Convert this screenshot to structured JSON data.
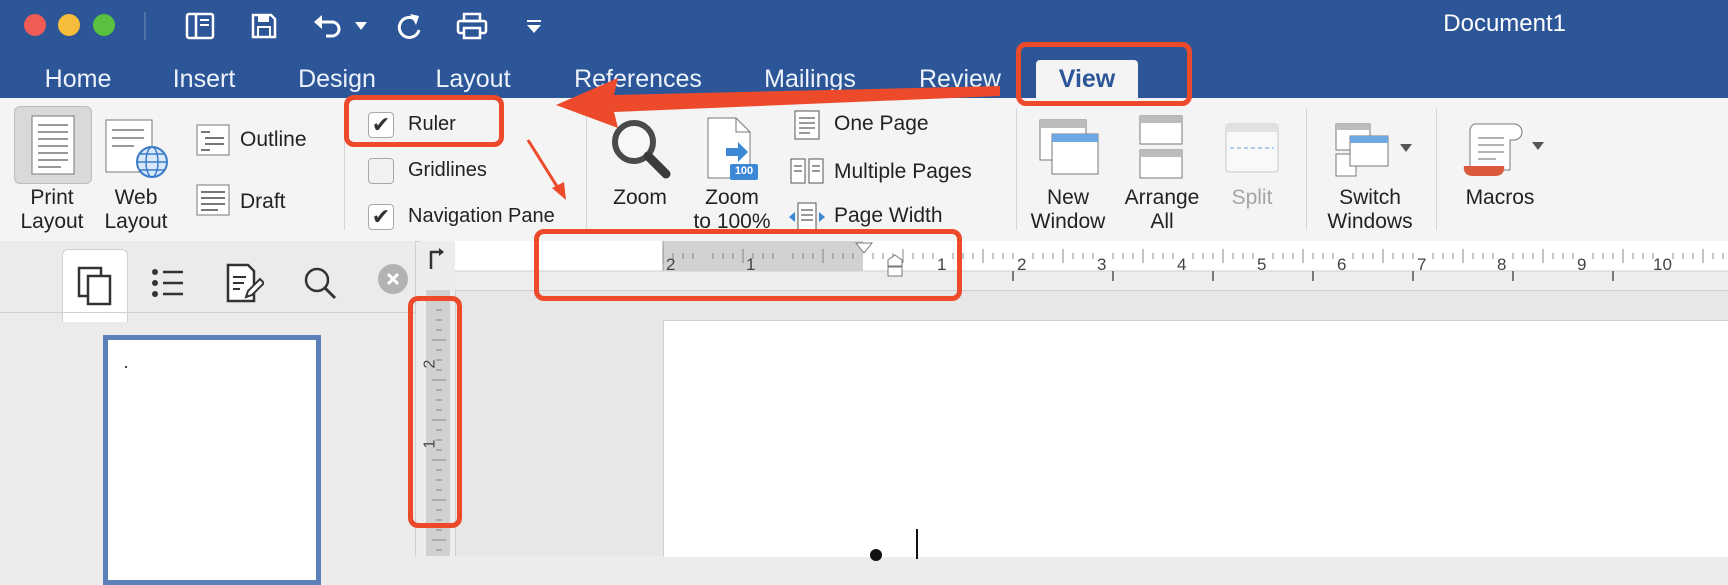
{
  "window": {
    "title": "Document1"
  },
  "tabs": [
    {
      "label": "Home"
    },
    {
      "label": "Insert"
    },
    {
      "label": "Design"
    },
    {
      "label": "Layout"
    },
    {
      "label": "References"
    },
    {
      "label": "Mailings"
    },
    {
      "label": "Review"
    },
    {
      "label": "View",
      "active": true
    }
  ],
  "ribbon": {
    "views": {
      "print_layout": "Print\nLayout",
      "web_layout": "Web\nLayout",
      "outline": "Outline",
      "draft": "Draft"
    },
    "show": {
      "ruler": {
        "label": "Ruler",
        "checked": true
      },
      "gridlines": {
        "label": "Gridlines",
        "checked": false
      },
      "navigation_pane": {
        "label": "Navigation Pane",
        "checked": true
      }
    },
    "zoom": {
      "zoom": "Zoom",
      "zoom_100": "Zoom\nto 100%",
      "zoom_100_badge": "100",
      "one_page": "One Page",
      "multiple_pages": "Multiple Pages",
      "page_width": "Page Width"
    },
    "window": {
      "new_window": "New\nWindow",
      "arrange_all": "Arrange\nAll",
      "split": "Split",
      "switch_windows": "Switch\nWindows"
    },
    "macros": {
      "label": "Macros"
    }
  },
  "ruler": {
    "horizontal_labels": [
      "2",
      "1",
      "1",
      "2",
      "3",
      "4",
      "5",
      "6",
      "7",
      "8",
      "9",
      "10"
    ],
    "vertical_labels": [
      "2",
      "1"
    ]
  },
  "colors": {
    "titlebar": "#2c5697",
    "annotation": "#ec4a2a",
    "close": "#ee5c55",
    "minimize": "#f5bd3a",
    "zoom": "#59c13f"
  }
}
